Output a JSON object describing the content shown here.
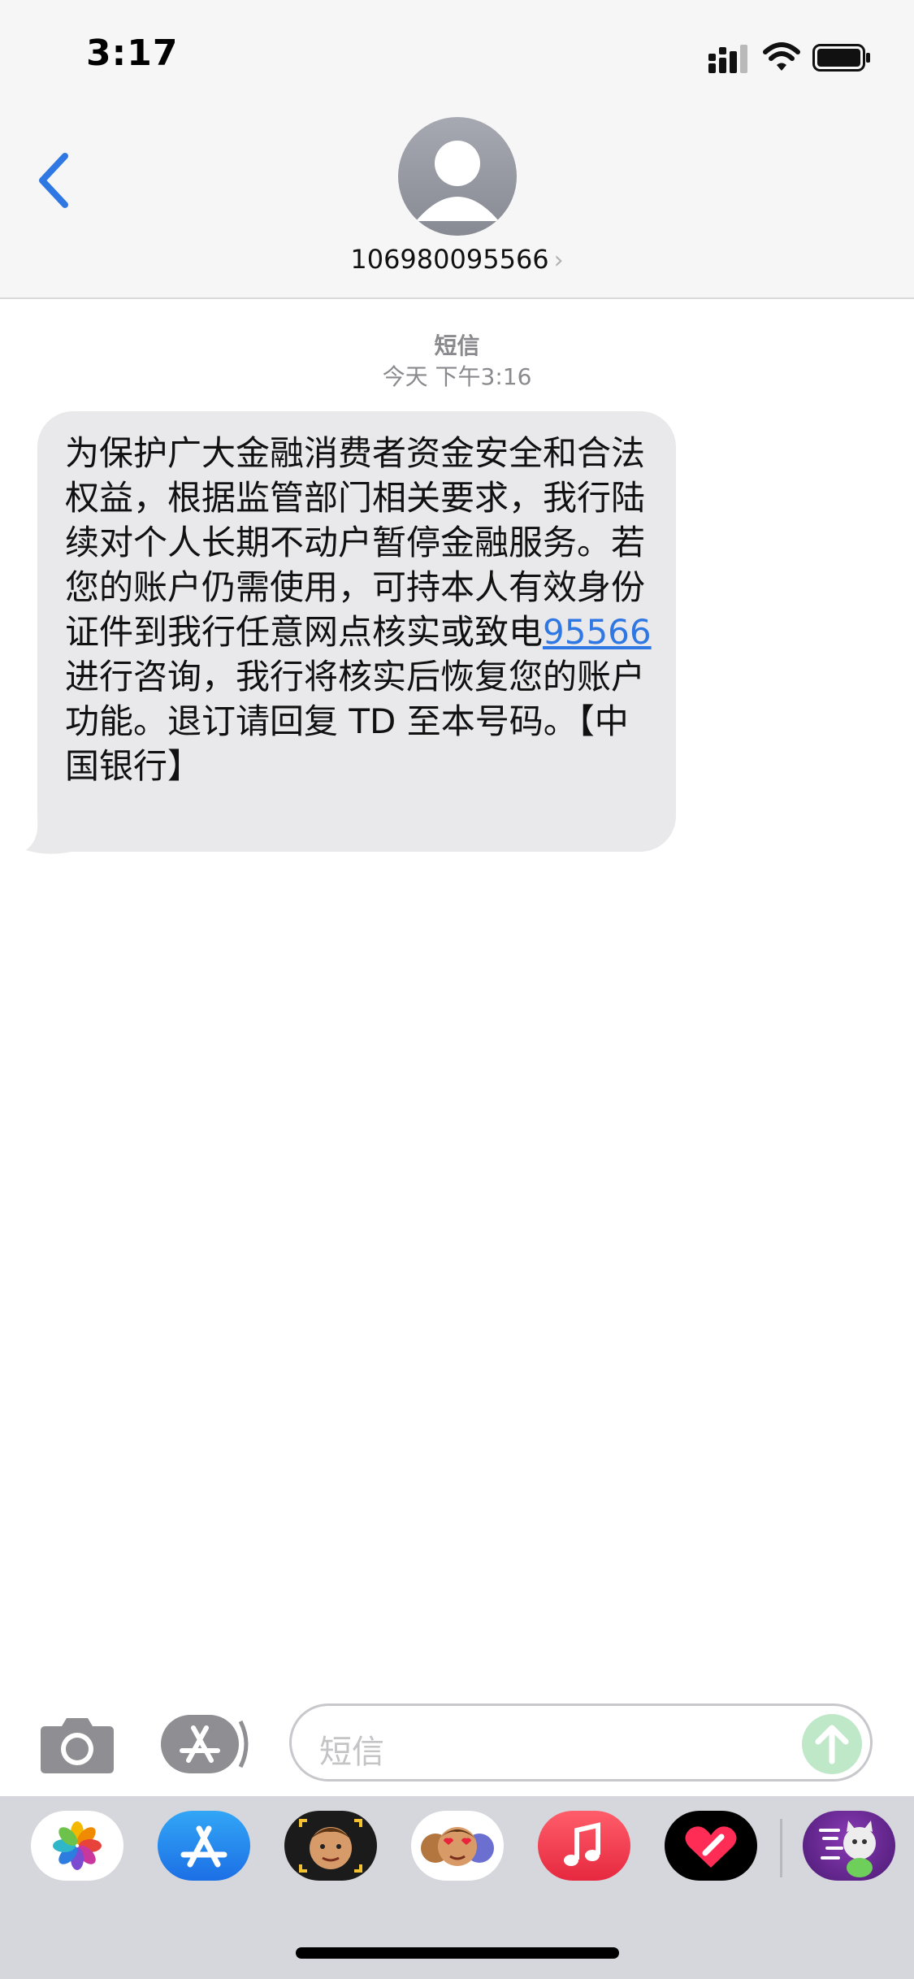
{
  "status_bar": {
    "time": "3:17"
  },
  "header": {
    "contact": "106980095566",
    "chevron": "›"
  },
  "thread": {
    "service": "短信",
    "timestamp": "今天 下午3:16",
    "message": {
      "before_link": "为保护广大金融消费者资金安全和合法权益，根据监管部门相关要求，我行陆续对个人长期不动户暂停金融服务。若您的账户仍需使用，可持本人有效身份证件到我行任意网点核实或致电",
      "link": "95566",
      "after_link": "进行咨询，我行将核实后恢复您的账户功能。退订请回复 TD 至本号码。【中国银行】"
    }
  },
  "composer": {
    "placeholder": "短信"
  },
  "app_drawer": {
    "icons": [
      "photos-icon",
      "app-store-icon",
      "memoji-icon",
      "animoji-stickers-icon",
      "music-icon",
      "digital-touch-icon",
      "game-icon"
    ]
  },
  "colors": {
    "accent": "#2f77e3",
    "bubble": "#e9e9eb",
    "send": "#bfe8c9",
    "header": "#f6f6f6"
  }
}
